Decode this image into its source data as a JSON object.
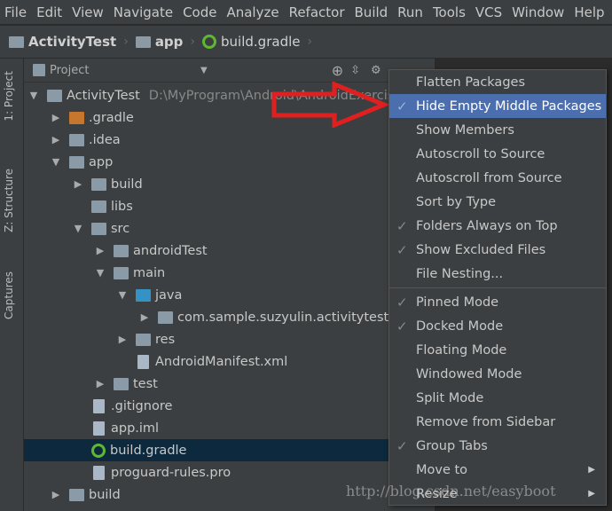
{
  "menubar": [
    "File",
    "Edit",
    "View",
    "Navigate",
    "Code",
    "Analyze",
    "Refactor",
    "Build",
    "Run",
    "Tools",
    "VCS",
    "Window",
    "Help"
  ],
  "breadcrumb": [
    "ActivityTest",
    "app",
    "build.gradle"
  ],
  "side_tabs": [
    "1: Project",
    "Z: Structure",
    "Captures"
  ],
  "panel": {
    "title": "Project"
  },
  "tree": [
    {
      "label": "ActivityTest",
      "path": "D:\\MyProgram\\Android\\AndroidExercise\\",
      "level": 0,
      "arrow": "down",
      "icon": "module"
    },
    {
      "label": ".gradle",
      "level": 1,
      "arrow": "right",
      "icon": "folder-orange"
    },
    {
      "label": ".idea",
      "level": 1,
      "arrow": "right",
      "icon": "folder"
    },
    {
      "label": "app",
      "level": 1,
      "arrow": "down",
      "icon": "module"
    },
    {
      "label": "build",
      "level": 2,
      "arrow": "right",
      "icon": "folder"
    },
    {
      "label": "libs",
      "level": 2,
      "arrow": "",
      "icon": "folder"
    },
    {
      "label": "src",
      "level": 2,
      "arrow": "down",
      "icon": "folder"
    },
    {
      "label": "androidTest",
      "level": 3,
      "arrow": "right",
      "icon": "folder"
    },
    {
      "label": "main",
      "level": 3,
      "arrow": "down",
      "icon": "folder"
    },
    {
      "label": "java",
      "level": 4,
      "arrow": "down",
      "icon": "folder-blue"
    },
    {
      "label": "com.sample.suzyulin.activitytest",
      "level": 5,
      "arrow": "right",
      "icon": "package"
    },
    {
      "label": "res",
      "level": 4,
      "arrow": "right",
      "icon": "folder"
    },
    {
      "label": "AndroidManifest.xml",
      "level": 4,
      "arrow": "",
      "icon": "file"
    },
    {
      "label": "test",
      "level": 3,
      "arrow": "right",
      "icon": "folder"
    },
    {
      "label": ".gitignore",
      "level": 2,
      "arrow": "",
      "icon": "file"
    },
    {
      "label": "app.iml",
      "level": 2,
      "arrow": "",
      "icon": "file"
    },
    {
      "label": "build.gradle",
      "level": 2,
      "arrow": "",
      "icon": "gradle",
      "selected": true
    },
    {
      "label": "proguard-rules.pro",
      "level": 2,
      "arrow": "",
      "icon": "file"
    },
    {
      "label": "build",
      "level": 1,
      "arrow": "right",
      "icon": "folder"
    }
  ],
  "menu": [
    {
      "label": "Flatten Packages"
    },
    {
      "label": "Hide Empty Middle Packages",
      "checked": true,
      "highlighted": true
    },
    {
      "label": "Show Members"
    },
    {
      "label": "Autoscroll to Source"
    },
    {
      "label": "Autoscroll from Source"
    },
    {
      "label": "Sort by Type"
    },
    {
      "label": "Folders Always on Top",
      "checked": true
    },
    {
      "label": "Show Excluded Files",
      "checked": true
    },
    {
      "label": "File Nesting..."
    },
    {
      "separator": true
    },
    {
      "label": "Pinned Mode",
      "checked": true
    },
    {
      "label": "Docked Mode",
      "checked": true
    },
    {
      "label": "Floating Mode"
    },
    {
      "label": "Windowed Mode"
    },
    {
      "label": "Split Mode"
    },
    {
      "label": "Remove from Sidebar"
    },
    {
      "label": "Group Tabs",
      "checked": true
    },
    {
      "label": "Move to",
      "submenu": true
    },
    {
      "label": "Resize",
      "submenu": true
    }
  ],
  "watermark": "http://blog.csdn.net/easyboot",
  "colors": {
    "highlight": "#4b6eaf",
    "selection": "#0d293e",
    "arrow": "#e02020"
  }
}
